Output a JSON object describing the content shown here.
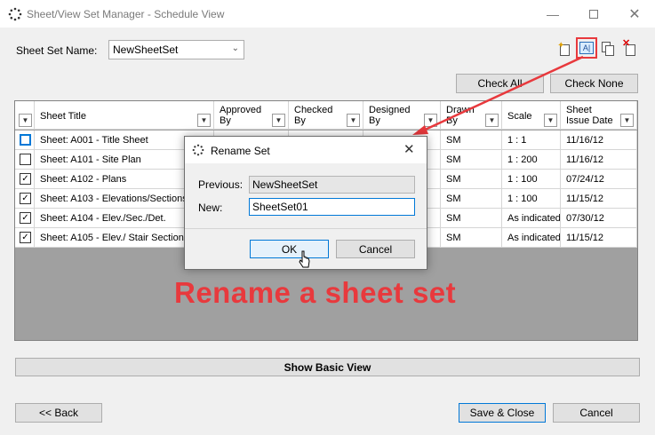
{
  "window": {
    "title": "Sheet/View Set Manager - Schedule View",
    "minimize_icon": "minimize-icon",
    "maximize_icon": "maximize-icon",
    "close_icon": "close-icon"
  },
  "sheet_set": {
    "label": "Sheet Set Name:",
    "value": "NewSheetSet"
  },
  "toolbar": {
    "icons": [
      "new-set-icon",
      "rename-set-icon",
      "duplicate-set-icon",
      "delete-set-icon"
    ],
    "rename_icon_text": "A|",
    "highlight_color": "#e8393d"
  },
  "buttons": {
    "check_all": "Check All",
    "check_none": "Check None",
    "show_basic_view": "Show Basic View",
    "back": "<< Back",
    "save_close": "Save & Close",
    "cancel": "Cancel"
  },
  "table": {
    "columns": [
      {
        "label": "",
        "filter": true
      },
      {
        "label": "Sheet Title",
        "filter": true
      },
      {
        "label": "Approved\nBy",
        "filter": true
      },
      {
        "label": "Checked\nBy",
        "filter": true
      },
      {
        "label": "Designed\nBy",
        "filter": true
      },
      {
        "label": "Drawn\nBy",
        "filter": true
      },
      {
        "label": "Scale",
        "filter": true
      },
      {
        "label": "Sheet\nIssue Date",
        "filter": true
      }
    ],
    "rows": [
      {
        "checked": false,
        "title": "Sheet: A001 - Title Sheet",
        "approved": "",
        "checked_by": "",
        "designed": "",
        "drawn": "SM",
        "scale": "1 : 1",
        "date": "11/16/12"
      },
      {
        "checked": false,
        "title": "Sheet: A101 - Site Plan",
        "approved": "",
        "checked_by": "",
        "designed": "",
        "drawn": "SM",
        "scale": "1 : 200",
        "date": "11/16/12"
      },
      {
        "checked": true,
        "title": "Sheet: A102 - Plans",
        "approved": "",
        "checked_by": "",
        "designed": "",
        "drawn": "SM",
        "scale": "1 : 100",
        "date": "07/24/12"
      },
      {
        "checked": true,
        "title": "Sheet: A103 - Elevations/Sections",
        "approved": "",
        "checked_by": "",
        "designed": "",
        "drawn": "SM",
        "scale": "1 : 100",
        "date": "11/15/12"
      },
      {
        "checked": true,
        "title": "Sheet: A104 - Elev./Sec./Det.",
        "approved": "",
        "checked_by": "",
        "designed": "",
        "drawn": "SM",
        "scale": "As indicated",
        "date": "07/30/12"
      },
      {
        "checked": true,
        "title": "Sheet: A105 - Elev./ Stair Sections",
        "approved": "",
        "checked_by": "",
        "designed": "",
        "drawn": "SM",
        "scale": "As indicated",
        "date": "11/15/12"
      }
    ]
  },
  "dialog": {
    "title": "Rename Set",
    "previous_label": "Previous:",
    "previous_value": "NewSheetSet",
    "new_label": "New:",
    "new_value": "SheetSet01",
    "ok": "OK",
    "cancel": "Cancel"
  },
  "annotation": {
    "text": "Rename a sheet set",
    "color": "#e8393d"
  }
}
